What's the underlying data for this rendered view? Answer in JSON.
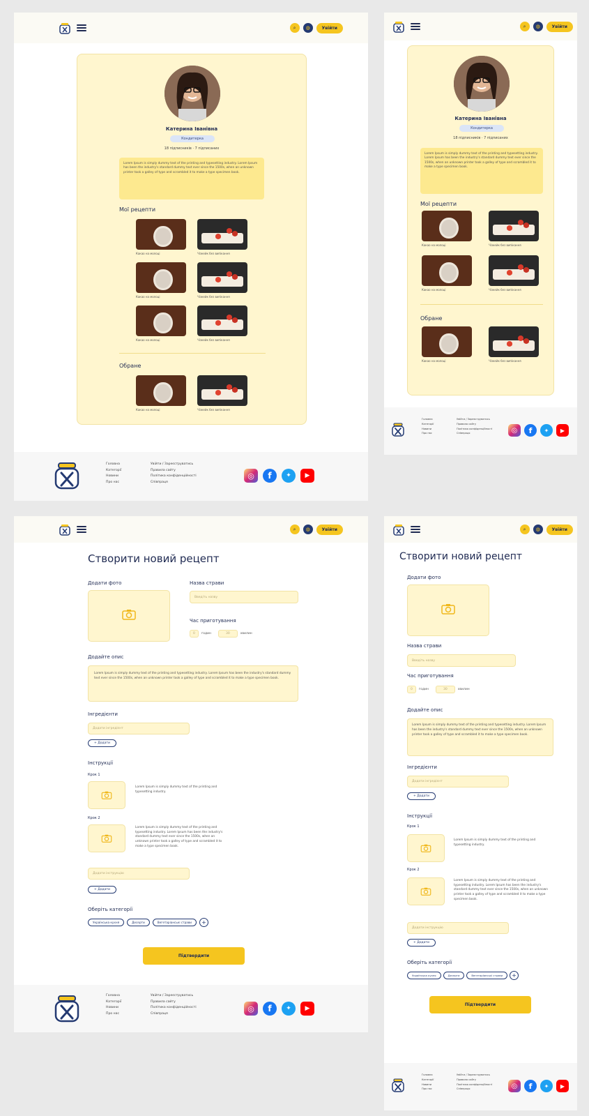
{
  "header": {
    "login_label": "Увійти",
    "search_icon": "search-icon",
    "globe_icon": "globe-icon"
  },
  "profile": {
    "name": "Катерина Іванівна",
    "badge": "Кондитерка",
    "stats": "18 підписників · 7 підписаних",
    "bio": "Lorem Ipsum is simply dummy text of the printing and typesetting industry. Lorem Ipsum has been the industry's standard dummy text ever since the 1500s, when an unknown printer took a galley of type and scrambled it to make a type specimen book.",
    "my_recipes_title": "Мої рецепти",
    "favorites_title": "Обране",
    "recipe_cocoa": "Какао на молоці",
    "recipe_cake": "Чізкейк без випікання"
  },
  "footer": {
    "col1": [
      "Головна",
      "Категорії",
      "Новини",
      "Про нас"
    ],
    "col2": [
      "Увійти / Зареєструватись",
      "Правила сайту",
      "Політика конфіденційності",
      "Співпраця"
    ],
    "social": [
      {
        "name": "instagram-icon",
        "glyph": "◎"
      },
      {
        "name": "facebook-icon",
        "glyph": "f"
      },
      {
        "name": "twitter-icon",
        "glyph": "✦"
      },
      {
        "name": "youtube-icon",
        "glyph": "▶"
      }
    ]
  },
  "create": {
    "title": "Створити новий рецепт",
    "add_photo": "Додати фото",
    "dish_name_label": "Назва страви",
    "dish_name_placeholder": "Введіть назву",
    "cook_time_label": "Час приготування",
    "hours_value": "0",
    "hours_label": "годин",
    "minutes_value": "30",
    "minutes_label": "хвилин",
    "description_label": "Додайте опис",
    "description_text": "Lorem Ipsum is simply dummy text of the printing and typesetting industry. Lorem Ipsum has been the industry's standard dummy text ever since the 1500s, when an unknown printer took a galley of type and scrambled it to make a type specimen book.",
    "ingredients_label": "Інгредієнти",
    "ingredient_placeholder": "Додати інгредієнт",
    "add_label": "+ Додати",
    "instructions_label": "Інструкції",
    "step1_label": "Крок 1",
    "step1_text": "Lorem Ipsum is simply dummy text of the printing and typesetting industry.",
    "step2_label": "Крок 2",
    "step2_text": "Lorem Ipsum is simply dummy text of the printing and typesetting industry. Lorem Ipsum has been the industry's standard dummy text ever since the 1500s, when an unknown printer took a galley of type and scrambled it to make a type specimen book.",
    "step_placeholder": "Додати інструкцію",
    "category_label": "Оберіть категорії",
    "categories": [
      "Українська кухня",
      "Десерти",
      "Вегетаріанські страви"
    ],
    "confirm_label": "Підтвердити"
  }
}
